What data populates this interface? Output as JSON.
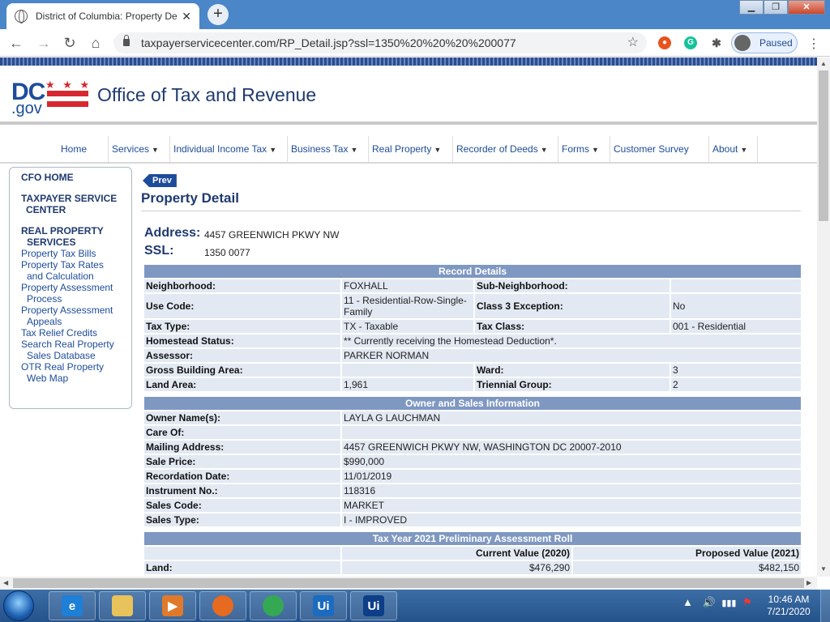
{
  "browser": {
    "tab_title": "District of Columbia: Property De",
    "url": "taxpayerservicecenter.com/RP_Detail.jsp?ssl=1350%20%20%20%200077",
    "profile_label": "Paused"
  },
  "header": {
    "logo_dc": "DC",
    "logo_gov": ".gov",
    "logo_stars": "★ ★ ★",
    "site_title": "Office of Tax and Revenue"
  },
  "nav": [
    {
      "label": "Home",
      "has_caret": false
    },
    {
      "label": "Services",
      "has_caret": true
    },
    {
      "label": "Individual Income Tax",
      "has_caret": true
    },
    {
      "label": "Business Tax",
      "has_caret": true
    },
    {
      "label": "Real Property",
      "has_caret": true
    },
    {
      "label": "Recorder of Deeds",
      "has_caret": true
    },
    {
      "label": "Forms",
      "has_caret": true
    },
    {
      "label": "Customer Survey",
      "has_caret": false
    },
    {
      "label": "About",
      "has_caret": true
    }
  ],
  "sidebar": {
    "cfo_home": "CFO HOME",
    "taxpayer_service_1": "TAXPAYER SERVICE",
    "taxpayer_service_2": "CENTER",
    "real_property_1": "REAL PROPERTY",
    "real_property_2": "SERVICES",
    "links": [
      [
        "Property Tax Bills"
      ],
      [
        "Property Tax Rates",
        "and Calculation"
      ],
      [
        "Property Assessment",
        "Process"
      ],
      [
        "Property Assessment",
        "Appeals"
      ],
      [
        "Tax Relief Credits"
      ],
      [
        "Search Real Property",
        "Sales Database"
      ],
      [
        "OTR Real Property",
        "Web Map"
      ]
    ]
  },
  "content": {
    "prev_label": "Prev",
    "title": "Property Detail",
    "address_label": "Address:",
    "address_value": "4457 GREENWICH PKWY NW",
    "ssl_label": "SSL:",
    "ssl_value": "1350 0077"
  },
  "record_details": {
    "header": "Record Details",
    "rows": [
      {
        "k1": "Neighborhood:",
        "v1": "FOXHALL",
        "k2": "Sub-Neighborhood:",
        "v2": ""
      },
      {
        "k1": "Use Code:",
        "v1": "11  -  Residential-Row-Single-Family",
        "k2": "Class 3 Exception:",
        "v2": "No"
      },
      {
        "k1": "Tax Type:",
        "v1": "TX  - Taxable",
        "k2": "Tax Class:",
        "v2": "001 -  Residential"
      },
      {
        "k1": "Homestead Status:",
        "v1": "** Currently receiving the Homestead Deduction*."
      },
      {
        "k1": "Assessor:",
        "v1": "PARKER NORMAN"
      },
      {
        "k1": "Gross Building Area:",
        "v1": "",
        "k2": "Ward:",
        "v2": "3"
      },
      {
        "k1": "Land Area:",
        "v1": "1,961",
        "k2": "Triennial Group:",
        "v2": "2"
      }
    ]
  },
  "owner_sales": {
    "header": "Owner and Sales Information",
    "rows": [
      {
        "k": "Owner Name(s):",
        "v": "LAYLA G LAUCHMAN"
      },
      {
        "k": "Care Of:",
        "v": ""
      },
      {
        "k": "Mailing Address:",
        "v": "4457 GREENWICH PKWY NW, WASHINGTON DC 20007-2010"
      },
      {
        "k": "Sale Price:",
        "v": "$990,000"
      },
      {
        "k": "Recordation Date:",
        "v": "11/01/2019"
      },
      {
        "k": "Instrument No.:",
        "v": "118316"
      },
      {
        "k": "Sales Code:",
        "v": "MARKET"
      },
      {
        "k": "Sales Type:",
        "v": "I - IMPROVED"
      }
    ]
  },
  "assessment": {
    "header": "Tax Year 2021 Preliminary Assessment Roll",
    "col_current": "Current Value (2020)",
    "col_proposed": "Proposed Value (2021)",
    "rows": [
      {
        "k": "Land:",
        "current": "$476,290",
        "proposed": "$482,150"
      }
    ]
  },
  "taskbar": {
    "clock_time": "10:46 AM",
    "clock_date": "7/21/2020",
    "apps": [
      {
        "name": "ie",
        "label": "e",
        "color": "#1e7fd6"
      },
      {
        "name": "explorer",
        "label": "",
        "color": "#e8c25a"
      },
      {
        "name": "media-player",
        "label": "▶",
        "color": "#e07a2a"
      },
      {
        "name": "firefox",
        "label": "",
        "color": "#e66a1f"
      },
      {
        "name": "chrome",
        "label": "",
        "color": "#34a853"
      },
      {
        "name": "uipath-1",
        "label": "Ui",
        "color": "#1b6bc0"
      },
      {
        "name": "uipath-2",
        "label": "Ui",
        "color": "#0d3e88"
      }
    ]
  }
}
